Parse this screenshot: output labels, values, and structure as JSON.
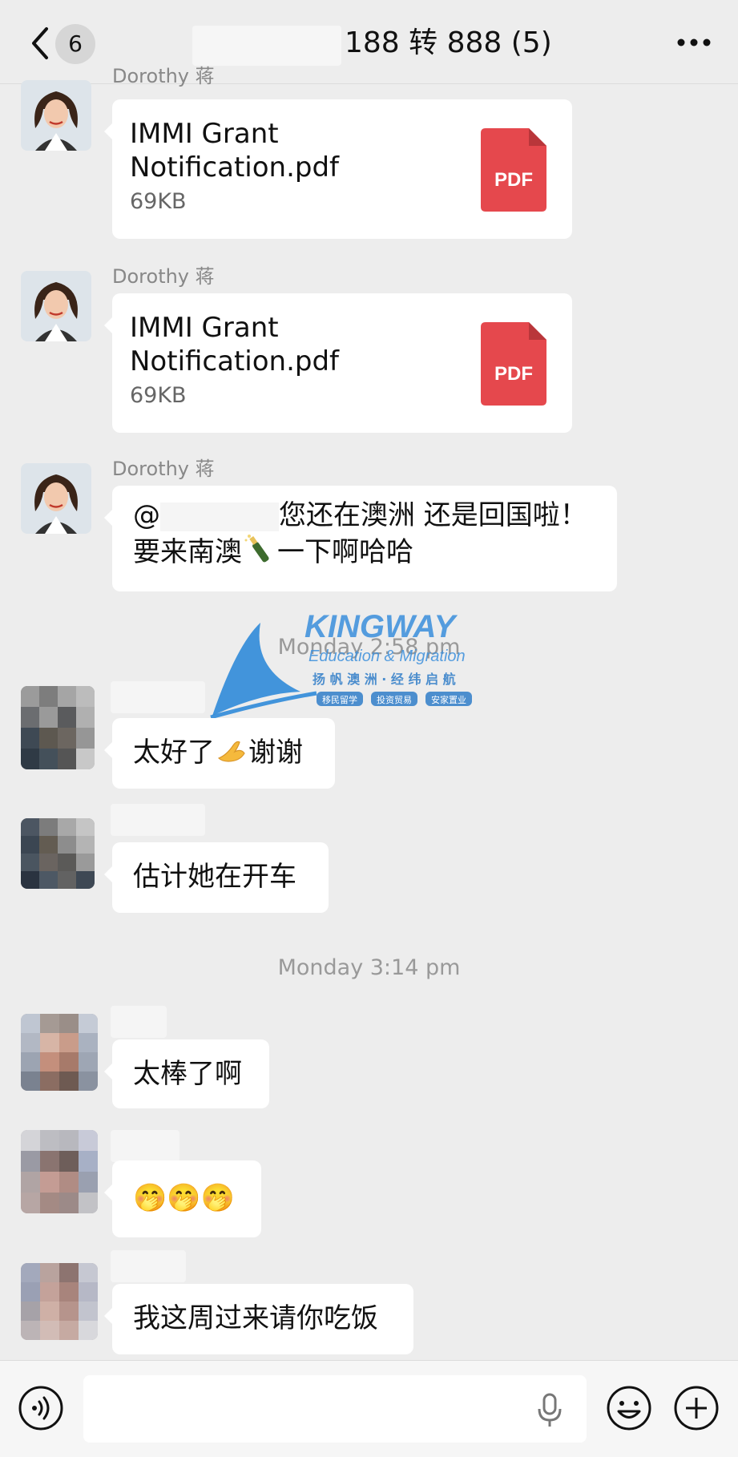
{
  "header": {
    "unread_count": "6",
    "title": "188 转 888 (5)"
  },
  "messages": [
    {
      "sender": "Dorothy 蒋",
      "file_name": "IMMI Grant\nNotification.pdf",
      "file_size": "69KB",
      "file_type": "PDF"
    },
    {
      "sender": "Dorothy 蒋",
      "file_name": "IMMI Grant\nNotification.pdf",
      "file_size": "69KB",
      "file_type": "PDF"
    },
    {
      "sender": "Dorothy 蒋",
      "mention_prefix": "@",
      "text_line1": "您还在澳洲 还是回国啦！",
      "text_line2_a": "要来南澳",
      "text_line2_b": "一下啊哈哈"
    },
    {
      "text": "太好了",
      "text_b": "谢谢"
    },
    {
      "text": "估计她在开车"
    },
    {
      "text": "太棒了啊"
    },
    {
      "text": "🤭🤭🤭"
    },
    {
      "text": "我这周过来请你吃饭"
    }
  ],
  "time_separators": [
    "Monday 2:58 pm",
    "Monday 3:14 pm"
  ],
  "watermark": {
    "brand": "KINGWAY",
    "sub": "Education & Migration",
    "slogan": "扬 帆 澳 洲 · 经 纬 启 航",
    "tags": [
      "移民留学",
      "投资贸易",
      "安家置业"
    ]
  },
  "icons": {
    "back": "chevron-left-icon",
    "more": "more-dots-icon",
    "voice": "voice-icon",
    "mic": "microphone-icon",
    "emoji": "emoji-icon",
    "plus": "plus-icon"
  }
}
